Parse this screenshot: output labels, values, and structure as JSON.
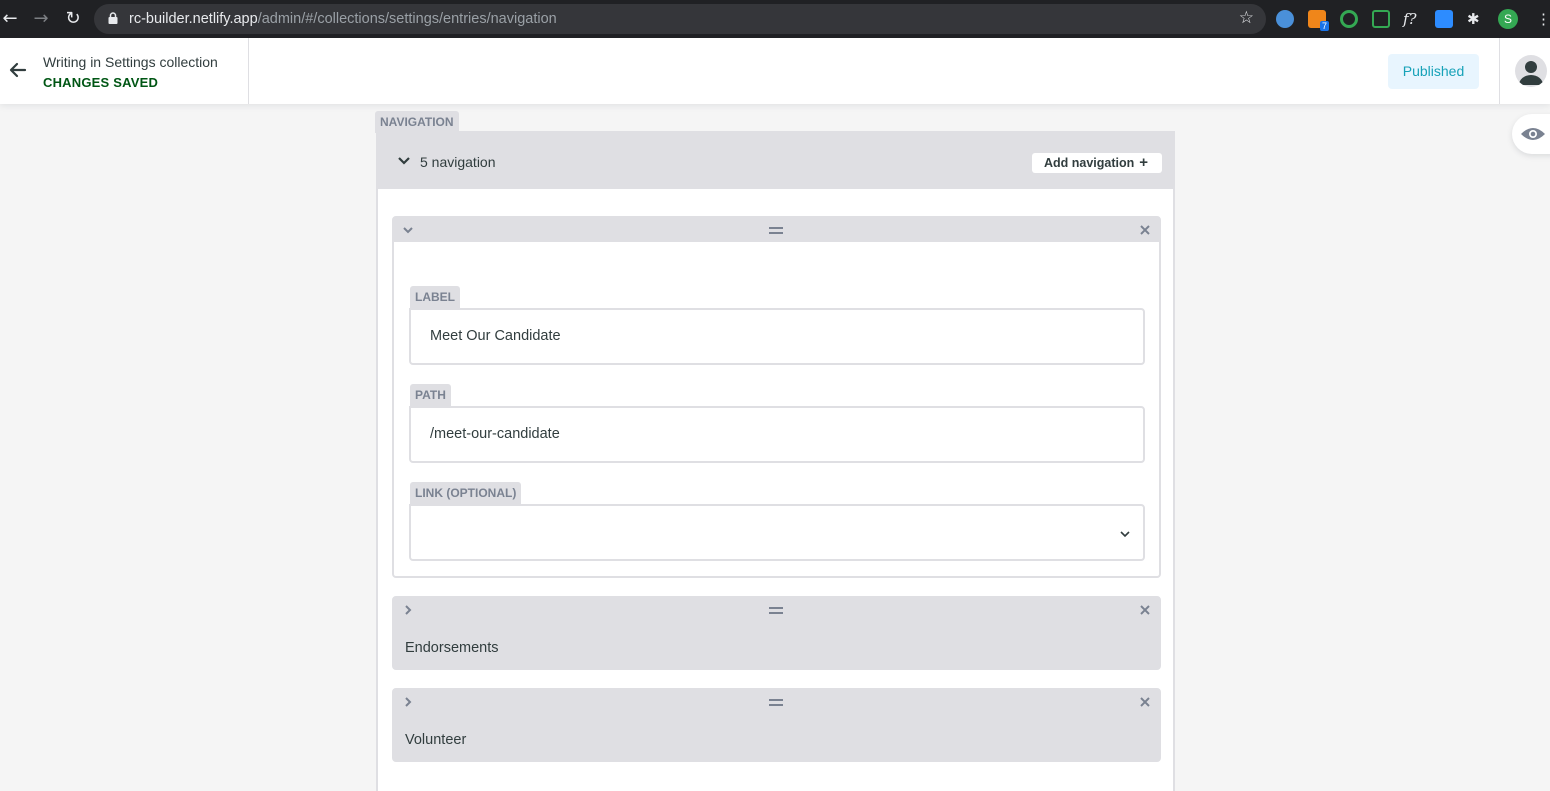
{
  "browser": {
    "url_host": "rc-builder.netlify.app",
    "url_path": "/admin/#/collections/settings/entries/navigation",
    "extension_badge": "7",
    "profile_initial": "S"
  },
  "header": {
    "title": "Writing in Settings collection",
    "status": "CHANGES SAVED",
    "publish_state": "Published"
  },
  "editor": {
    "field_label": "NAVIGATION",
    "count_text": "5 navigation",
    "add_button": "Add navigation",
    "add_symbol": "+",
    "expanded_item": {
      "label_field": {
        "label": "LABEL",
        "value": "Meet Our Candidate"
      },
      "path_field": {
        "label": "PATH",
        "value": "/meet-our-candidate"
      },
      "link_field": {
        "label": "LINK (OPTIONAL)",
        "value": ""
      }
    },
    "collapsed_items": [
      {
        "summary": "Endorsements"
      },
      {
        "summary": "Volunteer"
      }
    ]
  },
  "colors": {
    "status_green": "#005614",
    "published_text": "#17a2b8",
    "published_bg": "#e8f5fe",
    "label_gray": "#dfdfe3"
  }
}
